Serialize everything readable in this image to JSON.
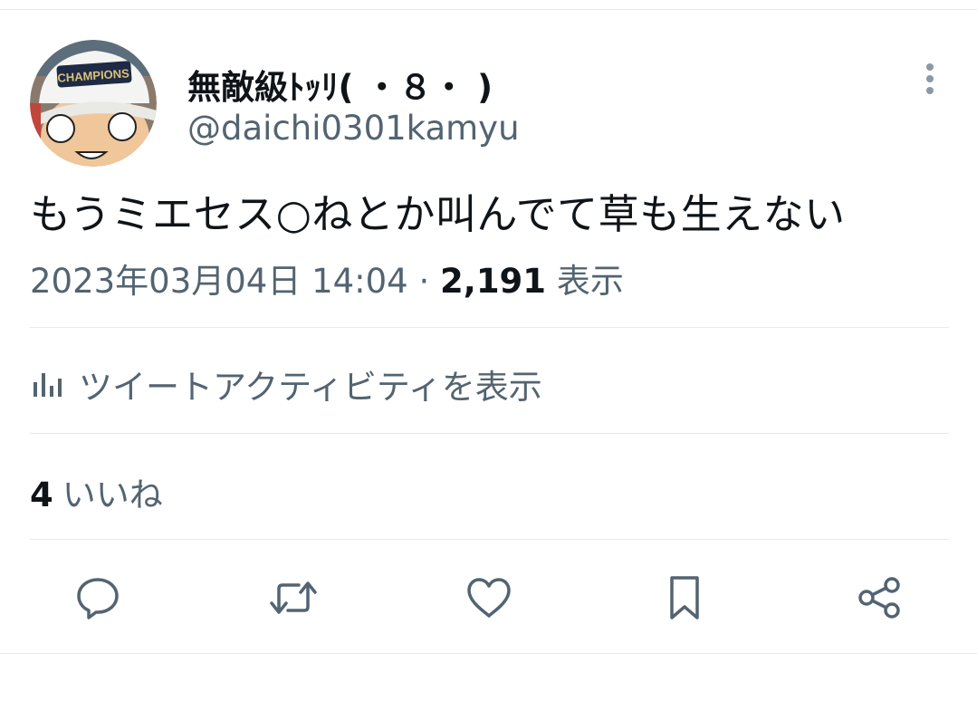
{
  "tweet": {
    "author": {
      "display_name": "無敵級ﾄｯﾘ( ・８・ )",
      "handle": "@daichi0301kamyu",
      "avatar_cap_text": "CHAMPIONS"
    },
    "text": "もうミエセス○ねとか叫んでて草も生えない",
    "timestamp": "2023年03月04日 14:04",
    "separator": "·",
    "views": "2,191",
    "views_label": "表示",
    "activity_label": "ツイートアクティビティを表示",
    "likes_count": "4",
    "likes_label": "いいね"
  },
  "actions": [
    {
      "name": "reply",
      "icon": "comment-icon"
    },
    {
      "name": "retweet",
      "icon": "retweet-icon"
    },
    {
      "name": "like",
      "icon": "heart-icon"
    },
    {
      "name": "bookmark",
      "icon": "bookmark-icon"
    },
    {
      "name": "share",
      "icon": "share-icon"
    }
  ],
  "colors": {
    "text_primary": "#0f1419",
    "text_secondary": "#536471",
    "divider": "#e6e9ec"
  }
}
